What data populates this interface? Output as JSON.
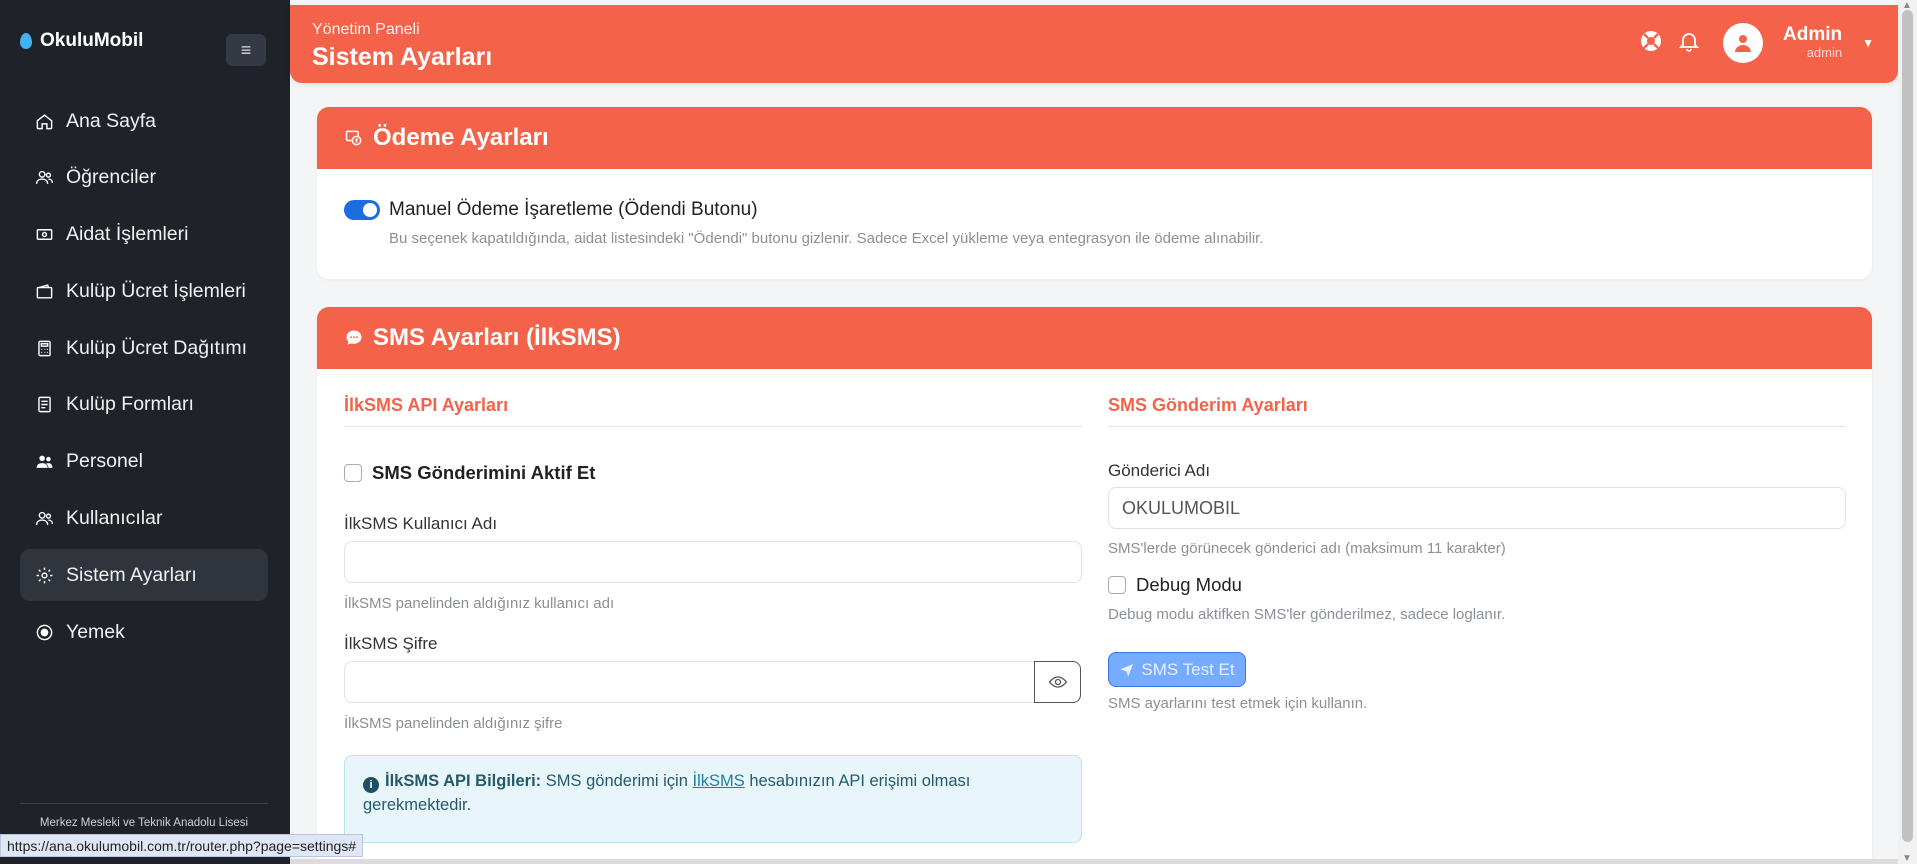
{
  "sidebar": {
    "brand": "OkuluMobil",
    "items": [
      {
        "label": "Ana Sayfa",
        "icon": "home-icon"
      },
      {
        "label": "Öğrenciler",
        "icon": "users-icon"
      },
      {
        "label": "Aidat İşlemleri",
        "icon": "cash-icon"
      },
      {
        "label": "Kulüp Ücret İşlemleri",
        "icon": "wallet-icon"
      },
      {
        "label": "Kulüp Ücret Dağıtımı",
        "icon": "calculator-icon"
      },
      {
        "label": "Kulüp Formları",
        "icon": "form-icon"
      },
      {
        "label": "Personel",
        "icon": "people-icon"
      },
      {
        "label": "Kullanıcılar",
        "icon": "user-group-icon"
      },
      {
        "label": "Sistem Ayarları",
        "icon": "gear-icon",
        "active": true
      },
      {
        "label": "Yemek",
        "icon": "record-icon"
      }
    ],
    "school": "Merkez Mesleki ve Teknik Anadolu Lisesi"
  },
  "header": {
    "breadcrumb": "Yönetim Paneli",
    "title": "Sistem Ayarları",
    "user_name": "Admin",
    "user_role": "admin"
  },
  "payment": {
    "title": "Ödeme Ayarları",
    "toggle_label": "Manuel Ödeme İşaretleme (Ödendi Butonu)",
    "toggle_on": true,
    "toggle_help": "Bu seçenek kapatıldığında, aidat listesindeki \"Ödendi\" butonu gizlenir. Sadece Excel yükleme veya entegrasyon ile ödeme alınabilir."
  },
  "sms": {
    "title": "SMS Ayarları (İlkSMS)",
    "api": {
      "section_title": "İlkSMS API Ayarları",
      "enable_label": "SMS Gönderimini Aktif Et",
      "username_label": "İlkSMS Kullanıcı Adı",
      "username_value": "",
      "username_help": "İlkSMS panelinden aldığınız kullanıcı adı",
      "password_label": "İlkSMS Şifre",
      "password_value": "",
      "password_help": "İlkSMS panelinden aldığınız şifre",
      "info_bold": "İlkSMS API Bilgileri:",
      "info_text_1": " SMS gönderimi için ",
      "info_link": "İlkSMS",
      "info_text_2": " hesabınızın API erişimi olması gerekmektedir."
    },
    "send": {
      "section_title": "SMS Gönderim Ayarları",
      "sender_label": "Gönderici Adı",
      "sender_value": "OKULUMOBIL",
      "sender_help": "SMS'lerde görünecek gönderici adı (maksimum 11 karakter)",
      "debug_label": "Debug Modu",
      "debug_help": "Debug modu aktifken SMS'ler gönderilmez, sadece loglanır.",
      "test_button": "SMS Test Et",
      "test_help": "SMS ayarlarını test etmek için kullanın."
    }
  },
  "status_url": "https://ana.okulumobil.com.tr/router.php?page=settings#",
  "colors": {
    "accent": "#f4624a",
    "sidebar": "#1f2229",
    "toggle": "#1e6de0"
  }
}
